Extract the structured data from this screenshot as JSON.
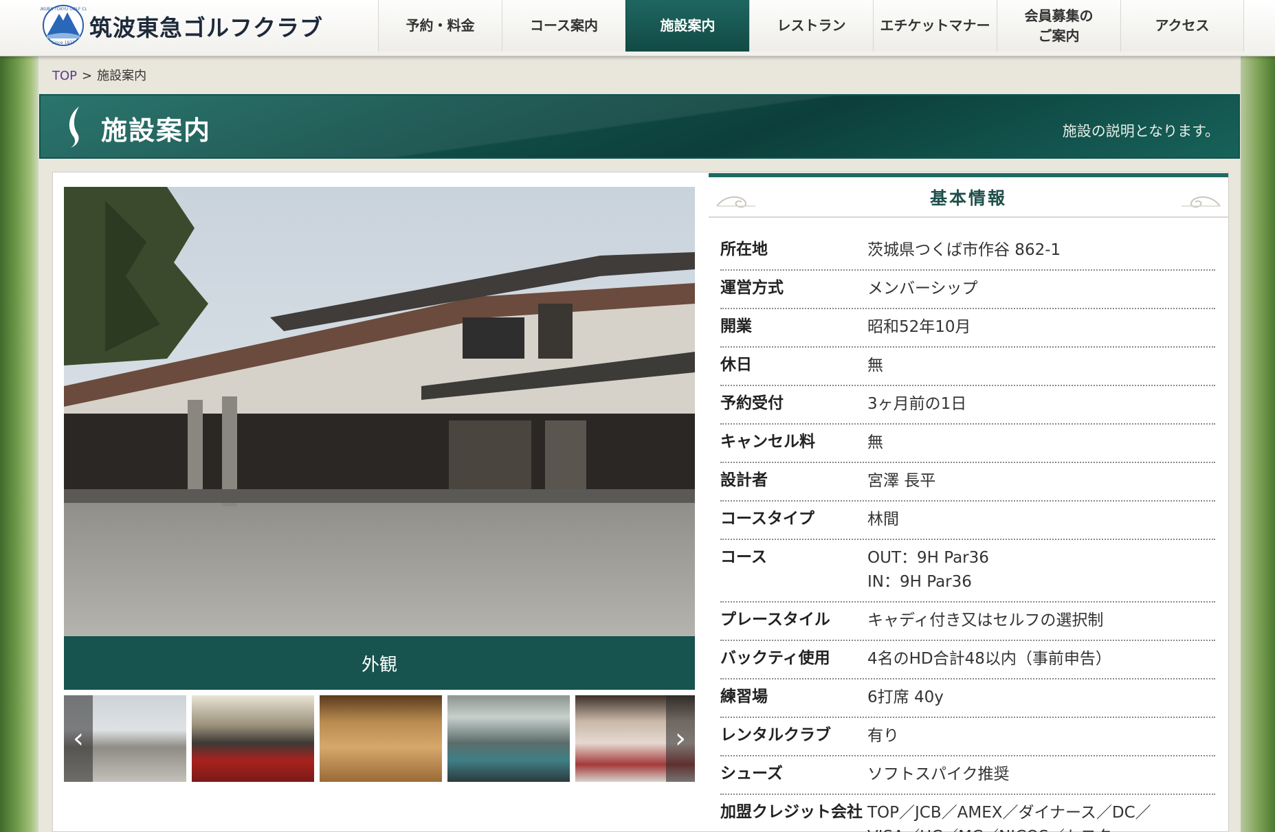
{
  "header": {
    "site_name": "筑波東急ゴルフクラブ",
    "nav": [
      {
        "label": "予約・料金"
      },
      {
        "label": "コース案内"
      },
      {
        "label": "施設案内",
        "active": true
      },
      {
        "label": "レストラン"
      },
      {
        "label": "エチケットマナー"
      },
      {
        "label": "会員募集の\nご案内"
      },
      {
        "label": "アクセス"
      }
    ]
  },
  "breadcrumb": {
    "home": "TOP",
    "separator": ">",
    "current": "施設案内"
  },
  "banner": {
    "title": "施設案内",
    "subtitle": "施設の説明となります。"
  },
  "gallery": {
    "caption": "外観",
    "prev_glyph": "‹",
    "next_glyph": "›",
    "thumbnails": [
      "exterior",
      "lounge",
      "locker-room",
      "bath",
      "shop"
    ]
  },
  "info": {
    "heading": "基本情報",
    "rows": [
      {
        "label": "所在地",
        "value": [
          "茨城県つくば市作谷 862-1"
        ]
      },
      {
        "label": "運営方式",
        "value": [
          "メンバーシップ"
        ]
      },
      {
        "label": "開業",
        "value": [
          "昭和52年10月"
        ]
      },
      {
        "label": "休日",
        "value": [
          "無"
        ]
      },
      {
        "label": "予約受付",
        "value": [
          "3ヶ月前の1日"
        ]
      },
      {
        "label": "キャンセル料",
        "value": [
          "無"
        ]
      },
      {
        "label": "設計者",
        "value": [
          "宮澤 長平"
        ]
      },
      {
        "label": "コースタイプ",
        "value": [
          "林間"
        ]
      },
      {
        "label": "コース",
        "value": [
          "OUT：9H Par36",
          "IN：9H Par36"
        ]
      },
      {
        "label": "プレースタイル",
        "value": [
          "キャディ付き又はセルフの選択制"
        ]
      },
      {
        "label": "バックティ使用",
        "value": [
          "4名のHD合計48以内（事前申告）"
        ]
      },
      {
        "label": "練習場",
        "value": [
          "6打席 40y"
        ]
      },
      {
        "label": "レンタルクラブ",
        "value": [
          "有り"
        ]
      },
      {
        "label": "シューズ",
        "value": [
          "ソフトスパイク推奨"
        ]
      },
      {
        "label": "加盟クレジット会社",
        "value": [
          "TOP／JCB／AMEX／ダイナース／DC／",
          "VISA／UC／MC／NICOS／トヨタ"
        ]
      }
    ]
  },
  "colors": {
    "accent": "#17534f",
    "link": "#5a3a8c"
  }
}
